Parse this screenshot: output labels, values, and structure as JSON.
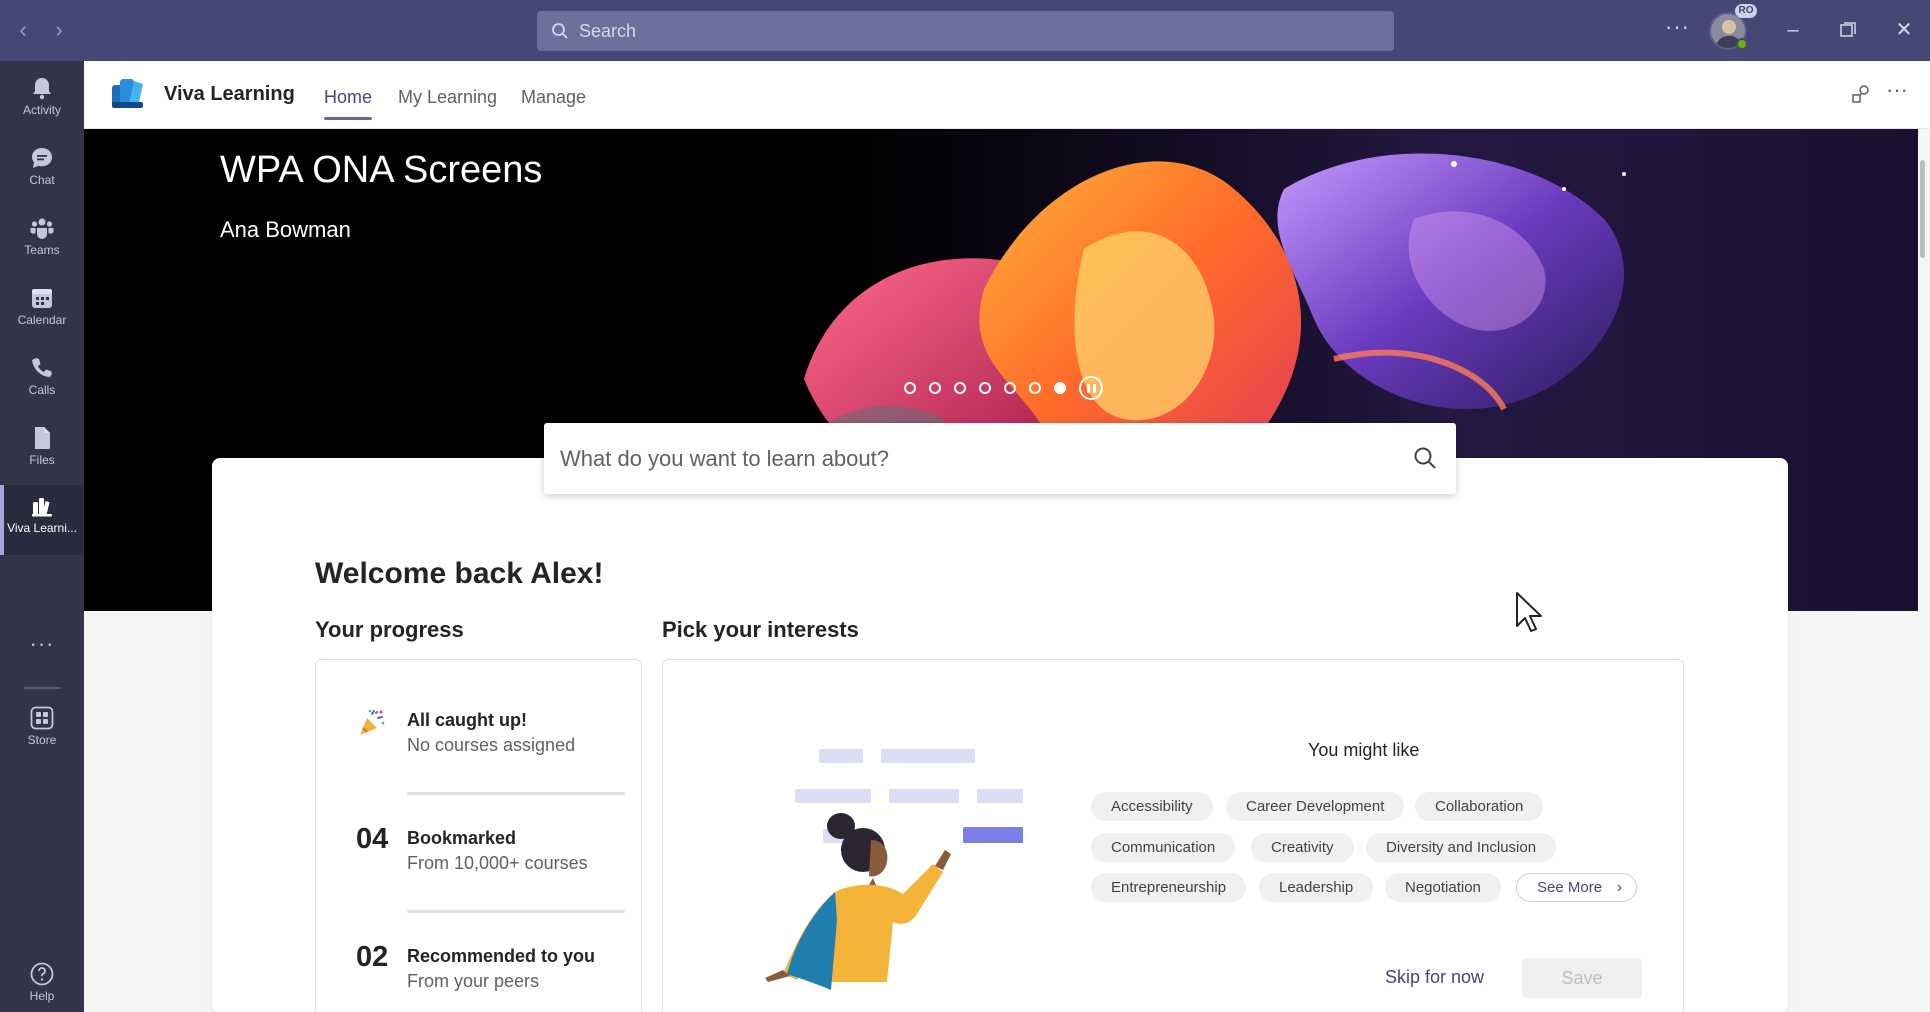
{
  "titlebar": {
    "search_placeholder": "Search",
    "avatar_badge": "RO",
    "colors": {
      "bar": "#464775",
      "search": "#6e6f9d"
    }
  },
  "rail": {
    "items": [
      {
        "label": "Activity",
        "icon": "bell-icon"
      },
      {
        "label": "Chat",
        "icon": "chat-icon"
      },
      {
        "label": "Teams",
        "icon": "teams-icon"
      },
      {
        "label": "Calendar",
        "icon": "calendar-icon"
      },
      {
        "label": "Calls",
        "icon": "phone-icon"
      },
      {
        "label": "Files",
        "icon": "file-icon"
      },
      {
        "label": "Viva Learni...",
        "icon": "viva-learning-icon",
        "active": true
      }
    ],
    "store_label": "Store",
    "help_label": "Help"
  },
  "app": {
    "name": "Viva Learning",
    "tabs": [
      {
        "label": "Home",
        "active": true
      },
      {
        "label": "My Learning"
      },
      {
        "label": "Manage"
      }
    ]
  },
  "hero": {
    "title": "WPA ONA Screens",
    "author": "Ana Bowman",
    "carousel_slides": 7,
    "carousel_active_index": 6
  },
  "learn_search": {
    "placeholder": "What do you want to learn about?"
  },
  "welcome": "Welcome back Alex!",
  "progress": {
    "heading": "Your progress",
    "caught_up": {
      "title": "All caught up!",
      "subtitle": "No courses assigned"
    },
    "bookmarked": {
      "count": "04",
      "title": "Bookmarked",
      "subtitle": "From 10,000+ courses"
    },
    "recommended": {
      "count": "02",
      "title": "Recommended to you",
      "subtitle": "From your peers"
    }
  },
  "interests": {
    "heading": "Pick your interests",
    "might_like": "You might like",
    "chips": [
      "Accessibility",
      "Career Development",
      "Collaboration",
      "Communication",
      "Creativity",
      "Diversity and Inclusion",
      "Entrepreneurship",
      "Leadership",
      "Negotiation"
    ],
    "see_more": "See More",
    "skip_label": "Skip for now",
    "save_label": "Save"
  }
}
